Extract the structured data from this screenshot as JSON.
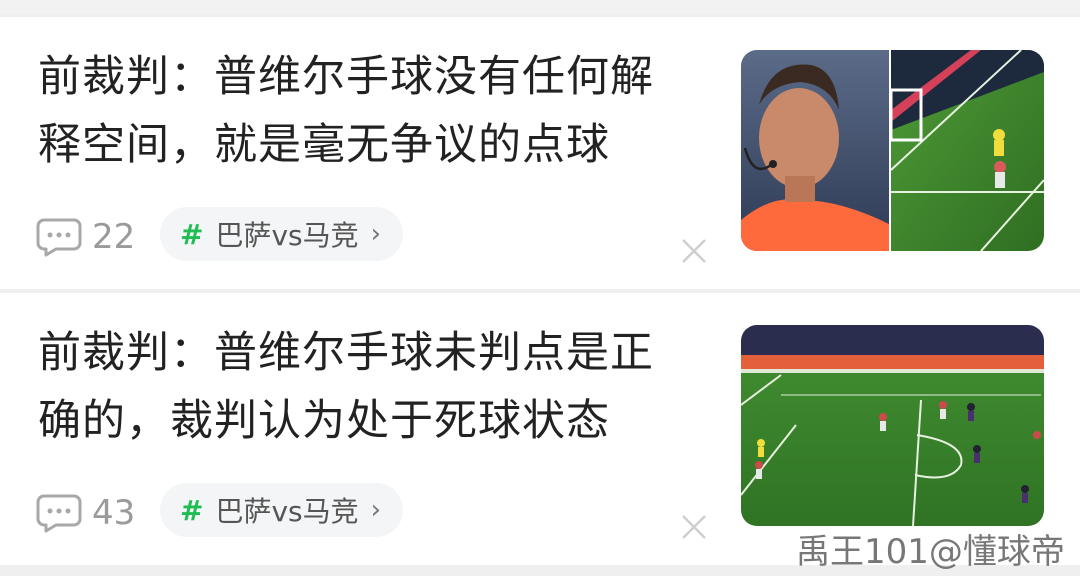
{
  "feed": {
    "items": [
      {
        "title": "前裁判：普维尔手球没有任何解释空间，就是毫无争议的点球",
        "comment_count": "22",
        "tag_label": "巴萨vs马竞",
        "tag_symbol": "#",
        "thumbnail": "referee-and-pitch-image"
      },
      {
        "title": "前裁判：普维尔手球未判点是正确的，裁判认为处于死球状态",
        "comment_count": "43",
        "tag_label": "巴萨vs马竞",
        "tag_symbol": "#",
        "thumbnail": "football-match-image"
      }
    ]
  },
  "watermark": "禹王101@懂球帝",
  "colors": {
    "background": "#efefef",
    "card": "#ffffff",
    "tag_hash": "#1fbd53",
    "meta_text": "#9a9a9a"
  },
  "icons": {
    "comment": "comment-bubble-icon",
    "close": "close-icon",
    "chevron": "chevron-right-icon"
  }
}
